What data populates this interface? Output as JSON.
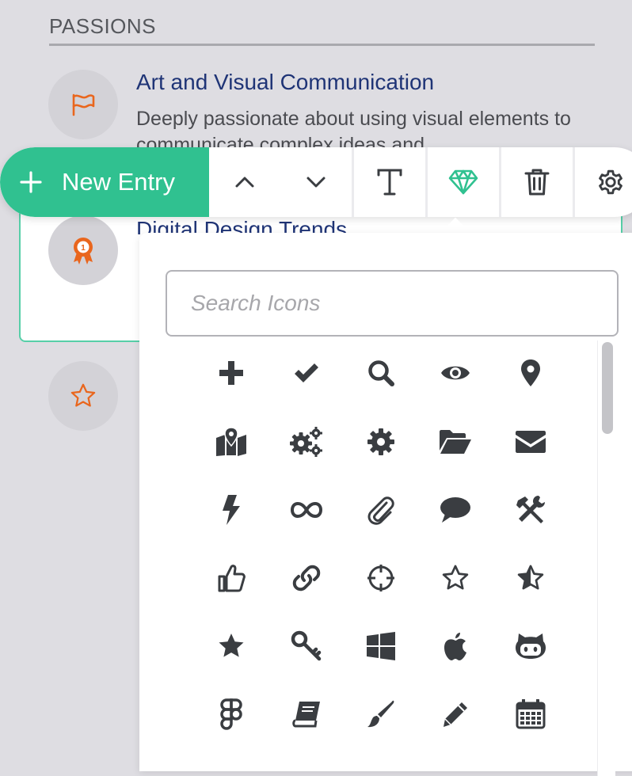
{
  "section": {
    "title": "PASSIONS"
  },
  "entries": [
    {
      "title": "Art and Visual Communication",
      "description": "Deeply passionate about using visual elements to communicate complex ideas and",
      "icon": "flag-icon"
    },
    {
      "title": "Digital Design Trends",
      "icon": "award-icon"
    },
    {
      "icon": "star-outline-icon"
    }
  ],
  "toolbar": {
    "new_entry_label": "New Entry",
    "buttons": [
      "move-up",
      "move-down",
      "text-format",
      "icon-picker",
      "delete",
      "settings"
    ]
  },
  "icon_picker": {
    "search_placeholder": "Search Icons",
    "icons": [
      "plus-icon",
      "check-icon",
      "search-icon",
      "eye-icon",
      "map-marker-icon",
      "map-location-icon",
      "cogs-icon",
      "cog-icon",
      "folder-open-icon",
      "envelope-icon",
      "bolt-icon",
      "infinity-icon",
      "paperclip-icon",
      "comment-icon",
      "tools-icon",
      "thumbs-up-icon",
      "link-icon",
      "crosshairs-icon",
      "star-outline-icon",
      "star-half-icon",
      "star-icon",
      "key-icon",
      "windows-icon",
      "apple-icon",
      "github-icon",
      "figma-icon",
      "book-icon",
      "paint-brush-icon",
      "pencil-icon",
      "calendar-icon"
    ]
  },
  "colors": {
    "accent_green": "#30c190",
    "icon_orange": "#e9661d",
    "title_navy": "#1f3476",
    "icon_dark": "#3a3d41"
  }
}
